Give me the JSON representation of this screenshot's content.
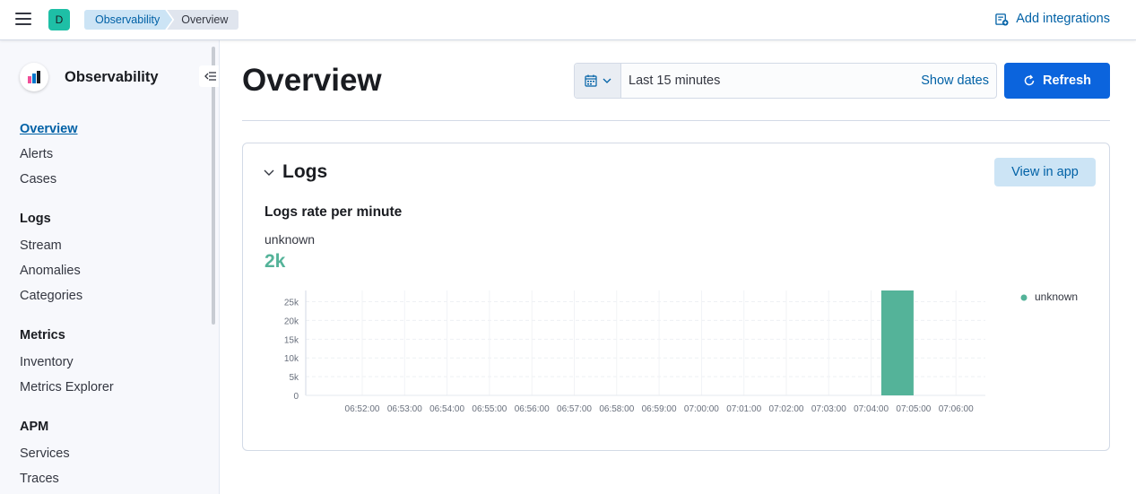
{
  "header": {
    "space_initial": "D",
    "breadcrumbs": [
      "Observability",
      "Overview"
    ],
    "add_integrations_label": "Add integrations"
  },
  "sidebar": {
    "title": "Observability",
    "sections": [
      {
        "heading": "",
        "items": [
          "Overview",
          "Alerts",
          "Cases"
        ]
      },
      {
        "heading": "Logs",
        "items": [
          "Stream",
          "Anomalies",
          "Categories"
        ]
      },
      {
        "heading": "Metrics",
        "items": [
          "Inventory",
          "Metrics Explorer"
        ]
      },
      {
        "heading": "APM",
        "items": [
          "Services",
          "Traces"
        ]
      }
    ],
    "active_item": "Overview"
  },
  "main": {
    "title": "Overview",
    "date_picker": {
      "range_label": "Last 15 minutes",
      "show_dates_label": "Show dates"
    },
    "refresh_label": "Refresh"
  },
  "logs_panel": {
    "title": "Logs",
    "view_in_app_label": "View in app",
    "chart_title": "Logs rate per minute",
    "stat_label": "unknown",
    "stat_value": "2k"
  },
  "colors": {
    "accent": "#0b64dd",
    "series": "#54b399",
    "link": "#0061a6"
  },
  "chart_data": {
    "type": "bar",
    "title": "Logs rate per minute",
    "categories": [
      "06:52:00",
      "06:53:00",
      "06:54:00",
      "06:55:00",
      "06:56:00",
      "06:57:00",
      "06:58:00",
      "06:59:00",
      "07:00:00",
      "07:01:00",
      "07:02:00",
      "07:03:00",
      "07:04:00",
      "07:05:00",
      "07:06:00"
    ],
    "series": [
      {
        "name": "unknown",
        "values": [
          0,
          0,
          0,
          0,
          0,
          0,
          0,
          0,
          0,
          0,
          0,
          0,
          0,
          28000,
          0
        ]
      }
    ],
    "y_ticks": [
      "0",
      "5k",
      "10k",
      "15k",
      "20k",
      "25k"
    ],
    "ylim": [
      0,
      28000
    ],
    "grid": true,
    "legend": "right"
  }
}
